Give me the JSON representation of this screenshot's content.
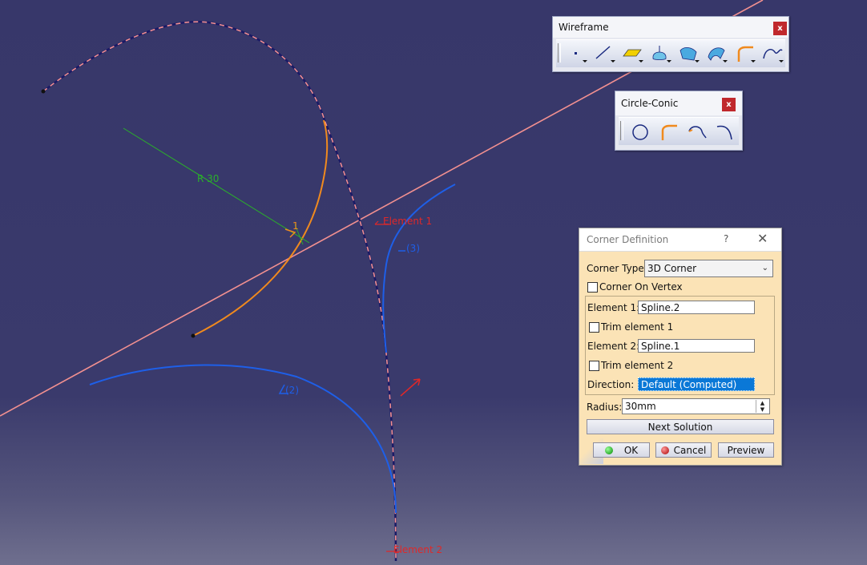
{
  "viewport": {
    "radius_label": "R 30",
    "element1_label": "Element 1",
    "element2_label": "Element 2",
    "marker3": "(3)",
    "marker2": "(2)",
    "marker1": "1"
  },
  "wireframe_toolbar": {
    "title": "Wireframe",
    "close": "x",
    "icons": [
      "point-icon",
      "line-icon",
      "plane-icon",
      "extrude-surface-icon",
      "fill-surface-icon",
      "sweep-surface-icon",
      "corner-icon",
      "spline-icon"
    ]
  },
  "circle_conic_toolbar": {
    "title": "Circle-Conic",
    "close": "x",
    "icons": [
      "circle-icon",
      "corner-icon",
      "connect-curve-icon",
      "conic-icon"
    ]
  },
  "corner_dialog": {
    "title": "Corner Definition",
    "help": "?",
    "close": "✕",
    "corner_type_label": "Corner Type:",
    "corner_type_value": "3D Corner",
    "corner_on_vertex": "Corner On Vertex",
    "element1_label": "Element 1:",
    "element1_value": "Spline.2",
    "trim1_label": "Trim element 1",
    "element2_label": "Element 2:",
    "element2_value": "Spline.1",
    "trim2_label": "Trim element 2",
    "direction_label": "Direction:",
    "direction_value": "Default (Computed)",
    "radius_label": "Radius:",
    "radius_value": "30mm",
    "next_solution": "Next Solution",
    "ok": "OK",
    "cancel": "Cancel",
    "preview": "Preview"
  },
  "colors": {
    "spline_dark": "#1a1a66",
    "highlight_pink": "#f29090",
    "corner_orange": "#f08a1e",
    "solution_blue": "#1e5fe8",
    "radius_green": "#2ab02a",
    "element_red": "#e02828"
  }
}
